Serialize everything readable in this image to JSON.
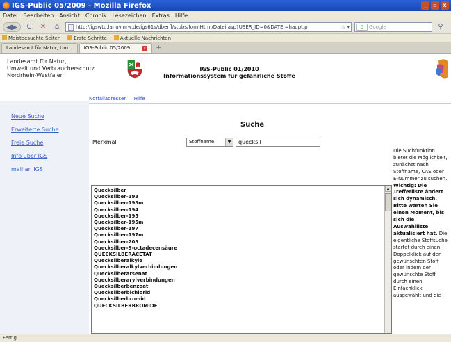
{
  "window": {
    "title": "IGS-Public 05/2009 - Mozilla Firefox"
  },
  "menu": [
    "Datei",
    "Bearbeiten",
    "Ansicht",
    "Chronik",
    "Lesezeichen",
    "Extras",
    "Hilfe"
  ],
  "navigation": {
    "url": "http://igswtu.lanuv.nrw.de/igs61s/dberfl/stubs/formHtml/Datei.asp?USER_ID=0&DATEI=haupt.p",
    "search_placeholder": "Google",
    "search_engine": "G"
  },
  "bookmarks": [
    "Meistbesuchte Seiten",
    "Erste Schritte",
    "Aktuelle Nachrichten"
  ],
  "tabs": [
    {
      "label": "Landesamt für Natur, Um..."
    },
    {
      "label": "IGS-Public 05/2009"
    }
  ],
  "page": {
    "org": [
      "Landesamt für Natur,",
      "Umwelt und Verbraucherschutz",
      "Nordrhein-Westfalen"
    ],
    "title_line1": "IGS-Public 01/2010",
    "title_line2": "Informationssystem für gefährliche Stoffe",
    "topnav": [
      "Notfalladressen",
      "Hilfe"
    ],
    "sidebar": [
      "Neue Suche",
      "Erweiterte Suche",
      "Freie Suche",
      "Info über IGS",
      "mail an IGS"
    ],
    "search_heading": "Suche",
    "merkmal_label": "Merkmal",
    "merkmal_selected": "Stoffname",
    "search_value": "quecksil",
    "help_parts": [
      "Die Suchfunktion bietet die Möglichkeit, zunächst nach Stoffname, CAS oder E-Nummer zu suchen. ",
      "Wichtig: Die Trefferliste ändert sich dynamisch. Bitte warten Sie einen Moment, bis sich die Auswahlliste aktualisiert hat.",
      " Die eigentliche Stoffsuche startet durch einen Doppelklick auf den gewünschten Stoff oder indem der gewünschte Stoff durch einen Einfachklick ausgewählt und die"
    ],
    "results": [
      "Quecksilber",
      "Quecksilber-193",
      "Quecksilber-193m",
      "Quecksilber-194",
      "Quecksilber-195",
      "Quecksilber-195m",
      "Quecksilber-197",
      "Quecksilber-197m",
      "Quecksilber-203",
      "Quecksilber-9-octadecensäure",
      "QUECKSILBERACETAT",
      "Quecksilberalkyle",
      "Quecksilberalkylverbindungen",
      "Quecksilberarsenat",
      "Quecksilberarylverbindungen",
      "Quecksilberbenzoat",
      "Quecksilberbichlorid",
      "Quecksilberbromid",
      "QUECKSILBERBROMIDE"
    ]
  },
  "status": "Fertig",
  "colors": {
    "titlebar": "#2a63d8",
    "link": "#2a4fb8",
    "sidebar_bg": "#eef2f8"
  }
}
